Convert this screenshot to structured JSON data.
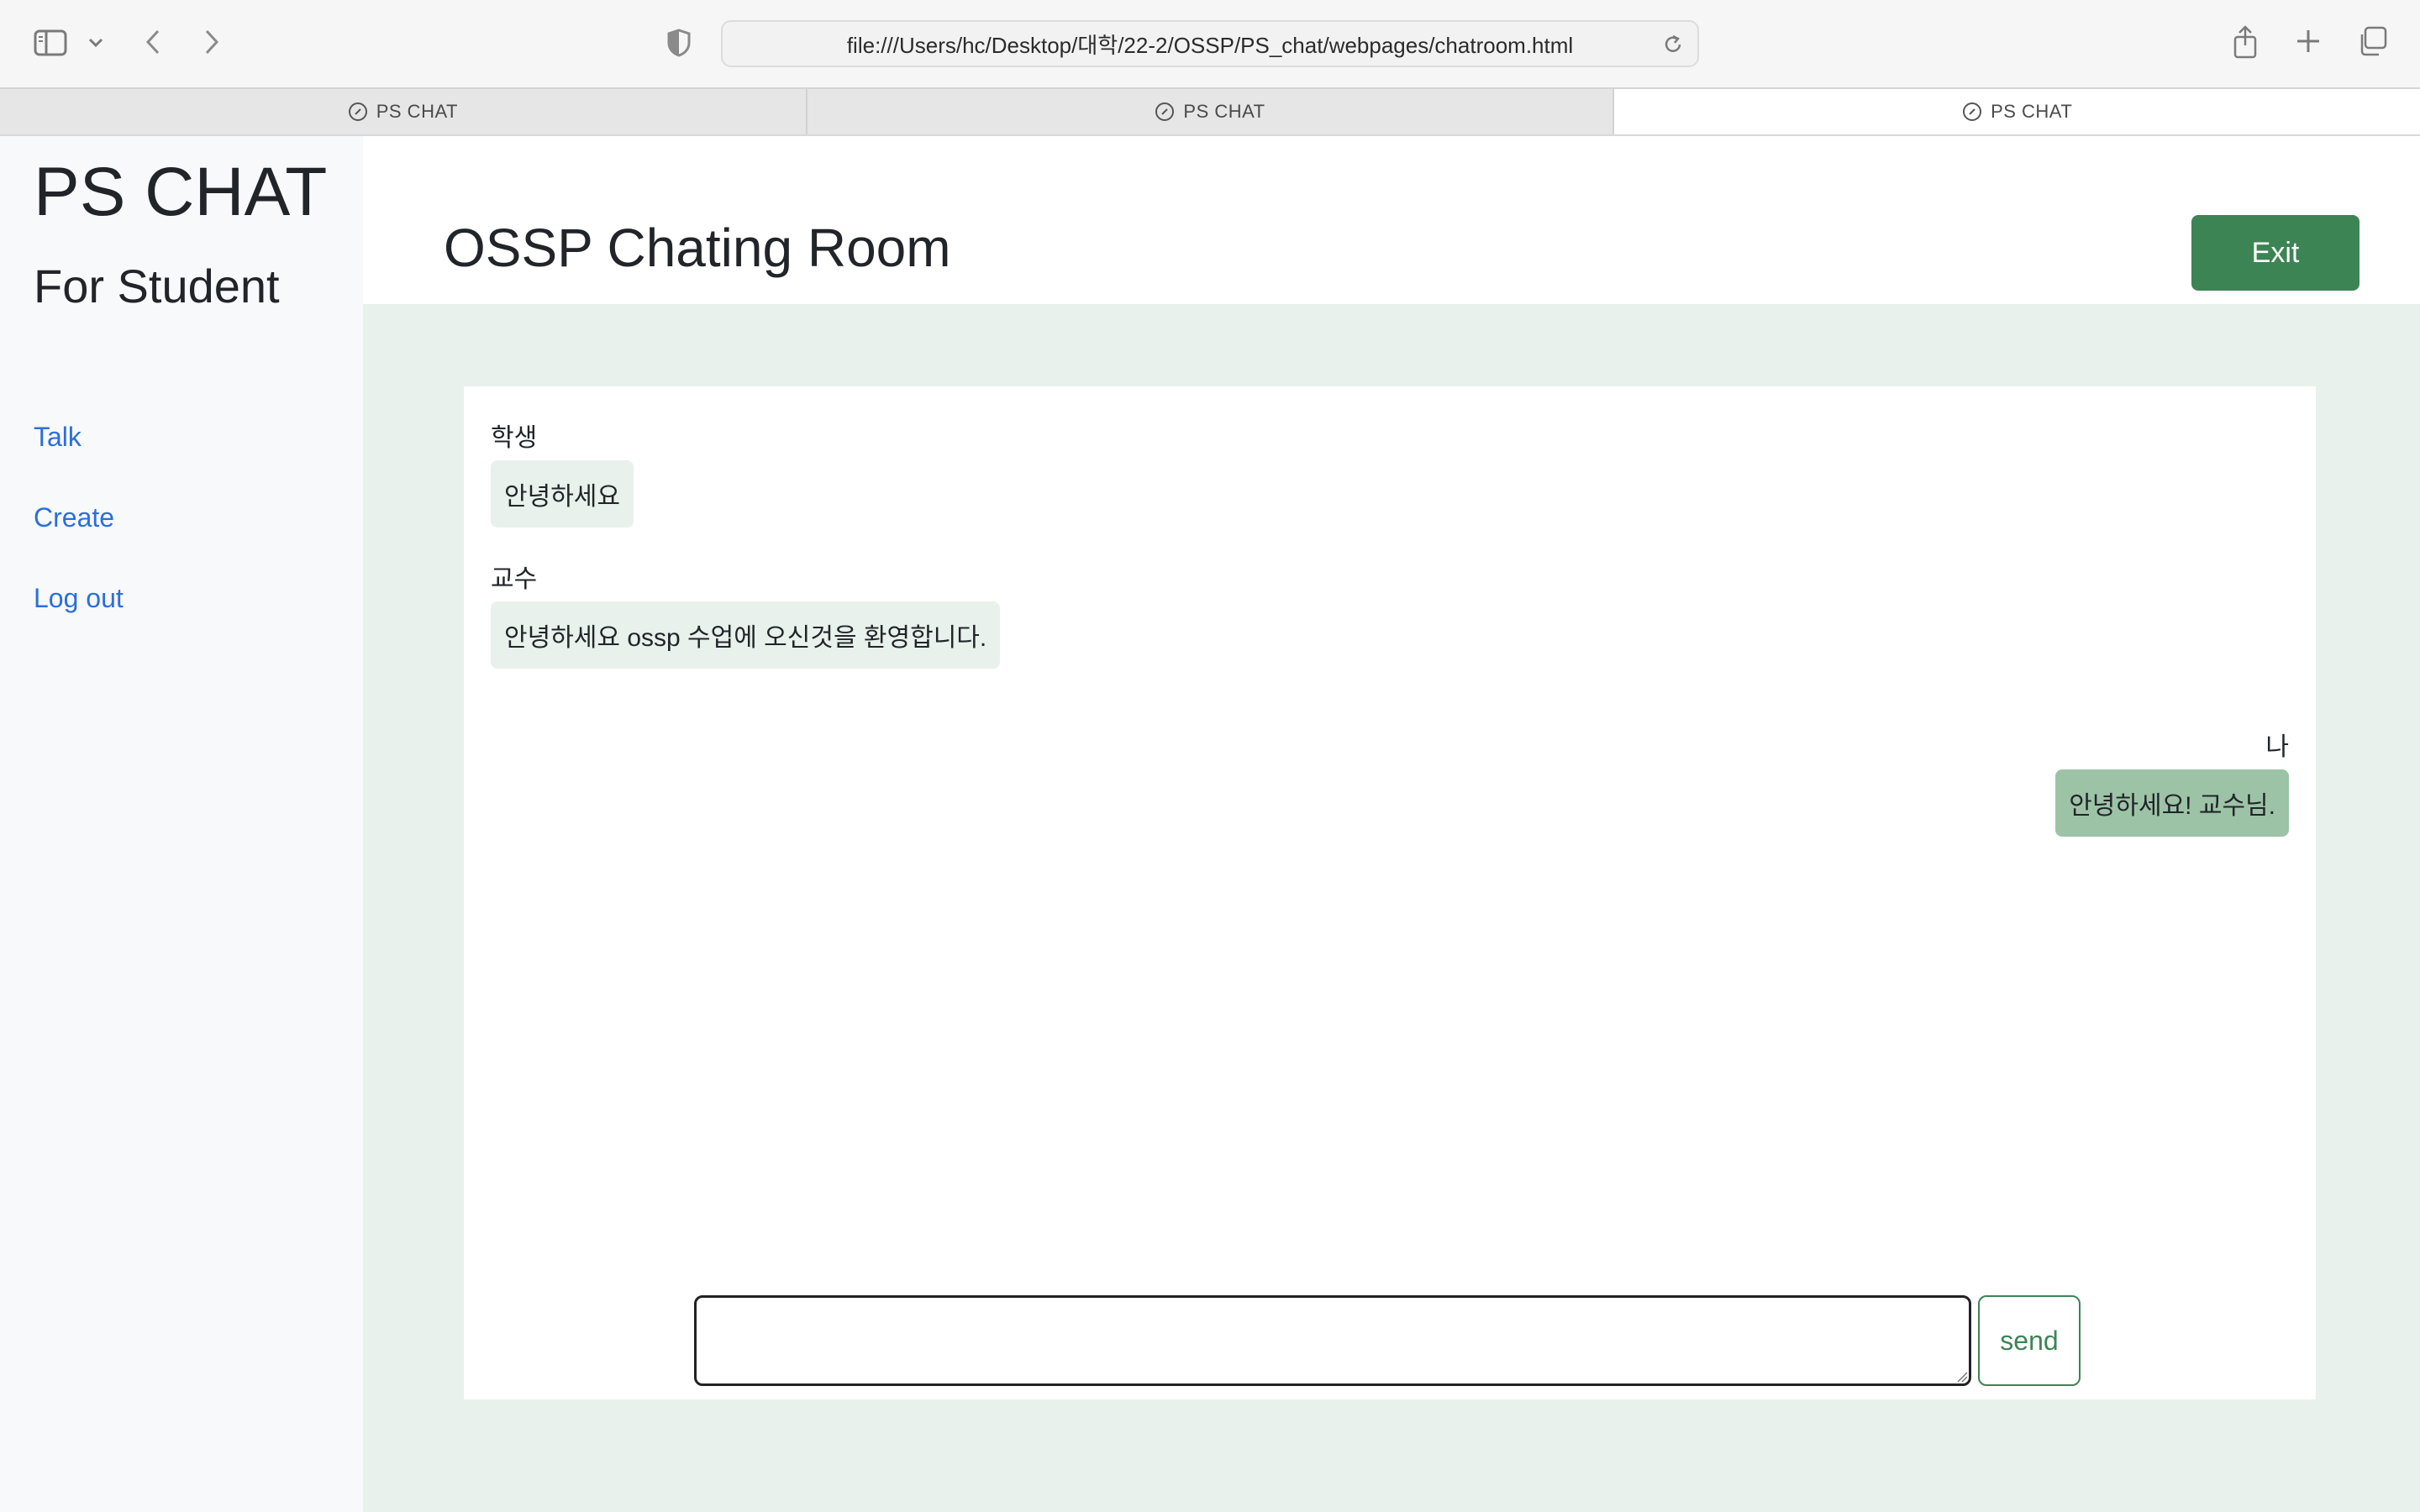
{
  "browser": {
    "url": "file:///Users/hc/Desktop/대학/22-2/OSSP/PS_chat/webpages/chatroom.html",
    "tabs": [
      {
        "label": "PS CHAT"
      },
      {
        "label": "PS CHAT"
      },
      {
        "label": "PS CHAT"
      }
    ],
    "icons": [
      "sidebar-icon",
      "chevron-down-icon",
      "back-icon",
      "forward-icon",
      "shield-icon",
      "reload-icon",
      "share-icon",
      "plus-icon",
      "tabs-overview-icon",
      "compass-icon"
    ]
  },
  "sidebar": {
    "brand": "PS CHAT",
    "subtitle": "For Student",
    "links": [
      {
        "label": "Talk"
      },
      {
        "label": "Create"
      },
      {
        "label": "Log out"
      }
    ]
  },
  "header": {
    "title": "OSSP Chating Room",
    "exit_label": "Exit"
  },
  "chat": {
    "messages": [
      {
        "sender": "학생",
        "text": "안녕하세요",
        "mine": false
      },
      {
        "sender": "교수",
        "text": "안녕하세요 ossp 수업에 오신것을 환영합니다.",
        "mine": false
      },
      {
        "sender": "나",
        "text": "안녕하세요! 교수님.",
        "mine": true
      }
    ],
    "input_value": "",
    "send_label": "send"
  },
  "colors": {
    "accent": "#3d8455",
    "link": "#2a6fdb",
    "main_bg": "#e9f1ec",
    "my_bubble": "#9dc3a7",
    "other_bubble": "#e9f1ec",
    "sidebar_bg": "#f8f9fa"
  }
}
